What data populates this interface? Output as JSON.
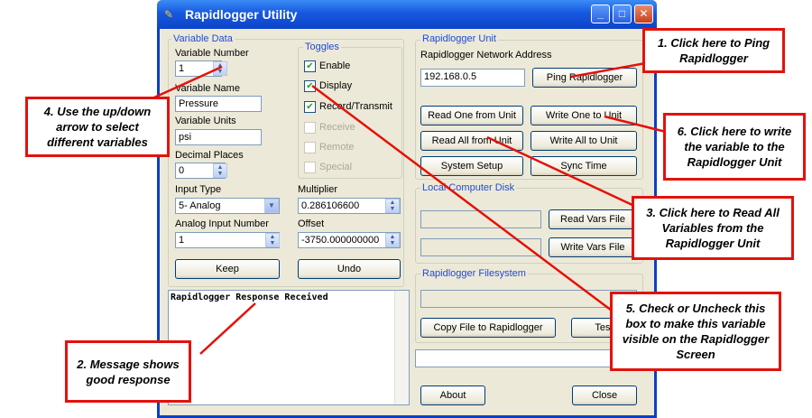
{
  "window": {
    "title": "Rapidlogger Utility"
  },
  "variable_data": {
    "group_label": "Variable Data",
    "number_label": "Variable Number",
    "number_value": "1",
    "name_label": "Variable Name",
    "name_value": "Pressure",
    "units_label": "Variable Units",
    "units_value": "psi",
    "decimal_label": "Decimal Places",
    "decimal_value": "0",
    "input_type_label": "Input Type",
    "input_type_value": "5- Analog",
    "multiplier_label": "Multiplier",
    "multiplier_value": "0.286106600",
    "analog_label": "Analog Input Number",
    "analog_value": "1",
    "offset_label": "Offset",
    "offset_value": "-3750.000000000",
    "keep_label": "Keep",
    "undo_label": "Undo"
  },
  "toggles": {
    "group_label": "Toggles",
    "items": [
      {
        "label": "Enable",
        "checked": true,
        "enabled": true
      },
      {
        "label": "Display",
        "checked": true,
        "enabled": true
      },
      {
        "label": "Record/Transmit",
        "checked": true,
        "enabled": true
      },
      {
        "label": "Receive",
        "checked": false,
        "enabled": false
      },
      {
        "label": "Remote",
        "checked": false,
        "enabled": false
      },
      {
        "label": "Special",
        "checked": false,
        "enabled": false
      }
    ]
  },
  "response": {
    "text": "Rapidlogger Response Received"
  },
  "unit": {
    "group_label": "Rapidlogger Unit",
    "address_label": "Rapidlogger Network Address",
    "address_value": "192.168.0.5",
    "ping_label": "Ping Rapidlogger",
    "read_one_label": "Read One from Unit",
    "write_one_label": "Write One to Unit",
    "read_all_label": "Read All from Unit",
    "write_all_label": "Write All to Unit",
    "system_setup_label": "System Setup",
    "sync_time_label": "Sync Time"
  },
  "local_disk": {
    "group_label": "Local Computer Disk",
    "read_vars_label": "Read Vars File",
    "write_vars_label": "Write Vars File"
  },
  "filesystem": {
    "group_label": "Rapidlogger Filesystem",
    "copy_label": "Copy File to Rapidlogger",
    "test_label": "Test"
  },
  "footer": {
    "about_label": "About",
    "close_label": "Close"
  },
  "callouts": {
    "c1": "1. Click here to Ping Rapidlogger",
    "c2": "2. Message shows good response",
    "c3": "3. Click here to Read All Variables from the Rapidlogger Unit",
    "c4": "4. Use the up/down arrow to select different variables",
    "c5": "5. Check or Uncheck this box to make this variable visible on the Rapidlogger Screen",
    "c6": "6. Click here to write the variable to the Rapidlogger Unit"
  },
  "colors": {
    "callout_border": "#e3120b",
    "titlebar": "#1658e0",
    "group_label": "#1f4bd4",
    "window_bg": "#ece9d8"
  }
}
